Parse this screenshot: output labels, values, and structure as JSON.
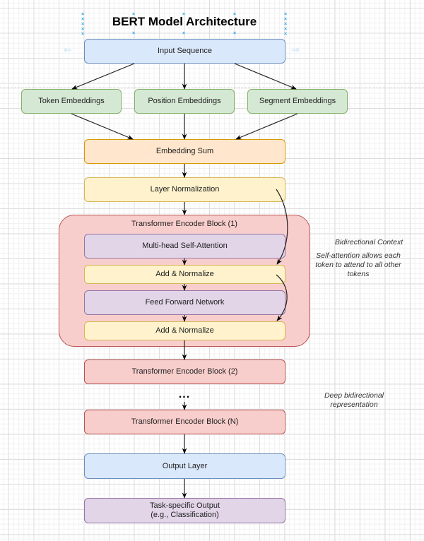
{
  "title": "BERT Model Architecture",
  "nodes": {
    "input_sequence": "Input Sequence",
    "token_embeddings": "Token Embeddings",
    "position_embeddings": "Position Embeddings",
    "segment_embeddings": "Segment Embeddings",
    "embedding_sum": "Embedding Sum",
    "layer_normalization": "Layer Normalization",
    "encoder_block_1": "Transformer Encoder Block (1)",
    "multi_head_attention": "Multi-head Self-Attention",
    "add_normalize_1": "Add & Normalize",
    "feed_forward": "Feed Forward Network",
    "add_normalize_2": "Add & Normalize",
    "encoder_block_2": "Transformer Encoder Block (2)",
    "ellipsis": "...",
    "encoder_block_n": "Transformer Encoder Block (N)",
    "output_layer": "Output Layer",
    "task_output_line1": "Task-specific Output",
    "task_output_line2": "(e.g., Classification)"
  },
  "annotations": {
    "bidirectional_context": "Bidirectional Context",
    "self_attention_line1": "Self-attention allows each",
    "self_attention_line2": "token to attend to all other",
    "self_attention_line3": "tokens",
    "deep_line1": "Deep bidirectional",
    "deep_line2": "representation"
  },
  "selection_handle_glyph": "×",
  "colors": {
    "blue": "#dae8fc",
    "green": "#d5e8d4",
    "orange": "#ffe6cc",
    "yellow": "#fff2cc",
    "purple": "#e1d5e7",
    "red": "#f8cecc",
    "handle": "#29a3e0"
  }
}
